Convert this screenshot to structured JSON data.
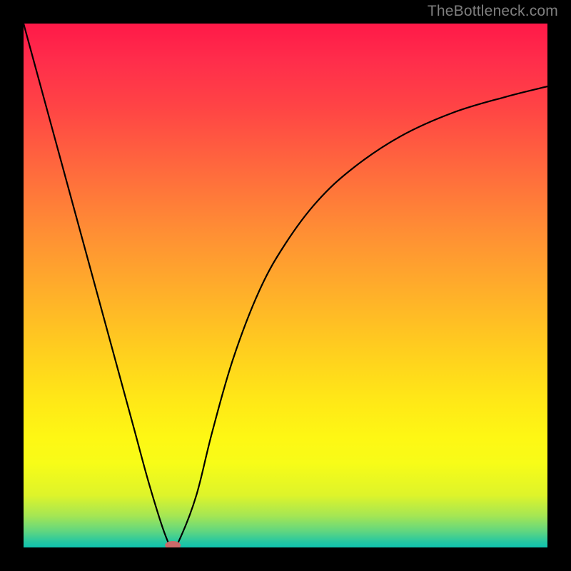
{
  "watermark": "TheBottleneck.com",
  "chart_data": {
    "type": "line",
    "title": "",
    "xlabel": "",
    "ylabel": "",
    "xlim": [
      0,
      100
    ],
    "ylim": [
      0,
      100
    ],
    "legend": false,
    "grid": false,
    "background_gradient": {
      "top": "#ff1948",
      "bottom": "#0fc3ae",
      "stops": [
        "#ff1948",
        "#ff6a3d",
        "#ffb129",
        "#ffe817",
        "#fef714",
        "#5ed681",
        "#0fc3ae"
      ]
    },
    "series": [
      {
        "name": "bottleneck-curve",
        "color": "#000000",
        "x": [
          0.0,
          3.0,
          6.0,
          9.0,
          12.0,
          15.0,
          18.0,
          21.0,
          24.0,
          27.0,
          28.5,
          30.0,
          33.0,
          36.0,
          40.0,
          45.0,
          50.0,
          56.0,
          63.0,
          72.0,
          82.0,
          92.0,
          100.0
        ],
        "y": [
          100.0,
          89.0,
          78.0,
          67.0,
          56.0,
          45.0,
          34.0,
          23.0,
          12.0,
          2.5,
          0.0,
          2.0,
          10.0,
          22.0,
          36.0,
          49.0,
          58.0,
          66.0,
          72.5,
          78.5,
          83.0,
          86.0,
          88.0
        ]
      }
    ],
    "marker": {
      "name": "minimum-point",
      "x": 28.5,
      "y": 0.0,
      "color": "#cc6a6a",
      "shape": "ellipse"
    }
  }
}
